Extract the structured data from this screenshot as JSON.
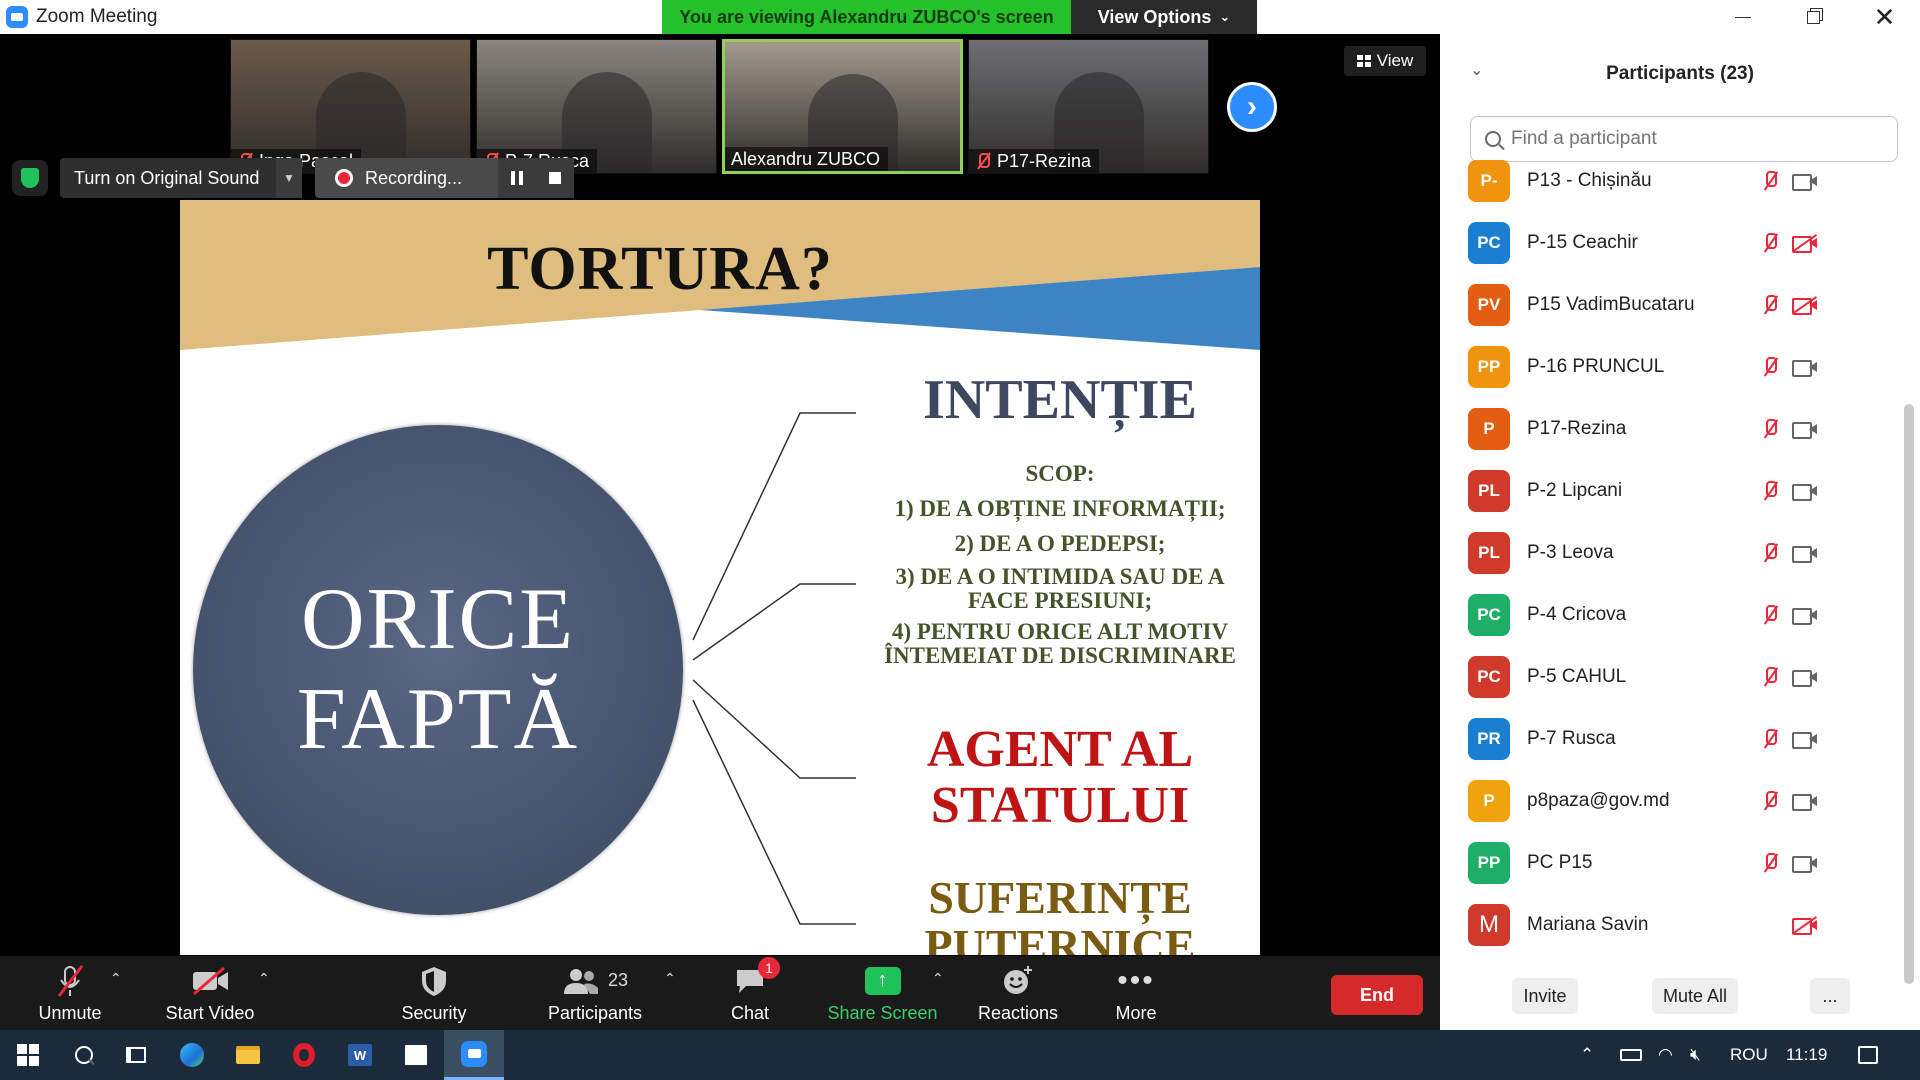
{
  "window": {
    "title": "Zoom Meeting",
    "viewing_banner": "You are viewing Alexandru ZUBCO's screen",
    "view_options_label": "View Options"
  },
  "video_strip": {
    "thumbnails": [
      {
        "name": "Inga Pascal",
        "muted": true,
        "active": false,
        "bg": "#6b5a4a"
      },
      {
        "name": "P-7 Rusca",
        "muted": true,
        "active": false,
        "bg": "#8a8580"
      },
      {
        "name": "Alexandru ZUBCO",
        "muted": false,
        "active": true,
        "bg": "#a39a8d"
      },
      {
        "name": "P17-Rezina",
        "muted": true,
        "active": false,
        "bg": "#6f6e72"
      }
    ],
    "view_label": "View"
  },
  "audio_bar": {
    "original_sound_label": "Turn on Original Sound",
    "recording_label": "Recording..."
  },
  "slide": {
    "title": "TORTURA?",
    "circle_line1": "ORICE",
    "circle_line2": "FAPTĂ",
    "intentie": "INTENȚIE",
    "scop_title": "SCOP:",
    "scop_items": [
      "1) DE A OBȚINE INFORMAȚII;",
      "2) DE A O PEDEPSI;",
      "3) DE A O INTIMIDA SAU DE A FACE PRESIUNI;",
      "4) PENTRU ORICE ALT MOTIV ÎNTEMEIAT DE DISCRIMINARE"
    ],
    "agent": "AGENT AL STATULUI",
    "suferinte": "SUFERINȚE PUTERNICE",
    "colors": {
      "tan": "#dfbd7e",
      "blue": "#3e84c3",
      "circle": "#46546f"
    }
  },
  "toolbar": {
    "unmute": "Unmute",
    "start_video": "Start Video",
    "security": "Security",
    "participants": "Participants",
    "participants_count": "23",
    "chat": "Chat",
    "chat_badge": "1",
    "share_screen": "Share Screen",
    "reactions": "Reactions",
    "more": "More",
    "end": "End"
  },
  "participants_panel": {
    "title": "Participants (23)",
    "search_placeholder": "Find a participant",
    "invite": "Invite",
    "mute_all": "Mute All",
    "more": "...",
    "items": [
      {
        "initials": "P-",
        "name": "P13 - Chișinău",
        "color": "#f0930f",
        "mic_muted": true,
        "cam_off": false
      },
      {
        "initials": "PC",
        "name": "P-15 Ceachir",
        "color": "#1a7fd1",
        "mic_muted": true,
        "cam_off": true
      },
      {
        "initials": "PV",
        "name": "P15 VadimBucataru",
        "color": "#e35d12",
        "mic_muted": true,
        "cam_off": true
      },
      {
        "initials": "PP",
        "name": "P-16 PRUNCUL",
        "color": "#f0930f",
        "mic_muted": true,
        "cam_off": false
      },
      {
        "initials": "P",
        "name": "P17-Rezina",
        "color": "#e35d12",
        "mic_muted": true,
        "cam_off": false
      },
      {
        "initials": "PL",
        "name": "P-2 Lipcani",
        "color": "#cf3a2b",
        "mic_muted": true,
        "cam_off": false
      },
      {
        "initials": "PL",
        "name": "P-3 Leova",
        "color": "#cf3a2b",
        "mic_muted": true,
        "cam_off": false
      },
      {
        "initials": "PC",
        "name": "P-4 Cricova",
        "color": "#1fae6a",
        "mic_muted": true,
        "cam_off": false
      },
      {
        "initials": "PC",
        "name": "P-5 CAHUL",
        "color": "#cf3a2b",
        "mic_muted": true,
        "cam_off": false
      },
      {
        "initials": "PR",
        "name": "P-7 Rusca",
        "color": "#1a7fd1",
        "mic_muted": true,
        "cam_off": false
      },
      {
        "initials": "P",
        "name": "p8paza@gov.md",
        "color": "#f0a30f",
        "mic_muted": true,
        "cam_off": false
      },
      {
        "initials": "PP",
        "name": "PC P15",
        "color": "#1fae6a",
        "mic_muted": true,
        "cam_off": false
      },
      {
        "initials": "M",
        "name": "Mariana Savin",
        "color": "#cf3a2b",
        "mic_muted": false,
        "cam_off": true
      }
    ]
  },
  "taskbar": {
    "language": "ROU",
    "time": "11:19"
  }
}
